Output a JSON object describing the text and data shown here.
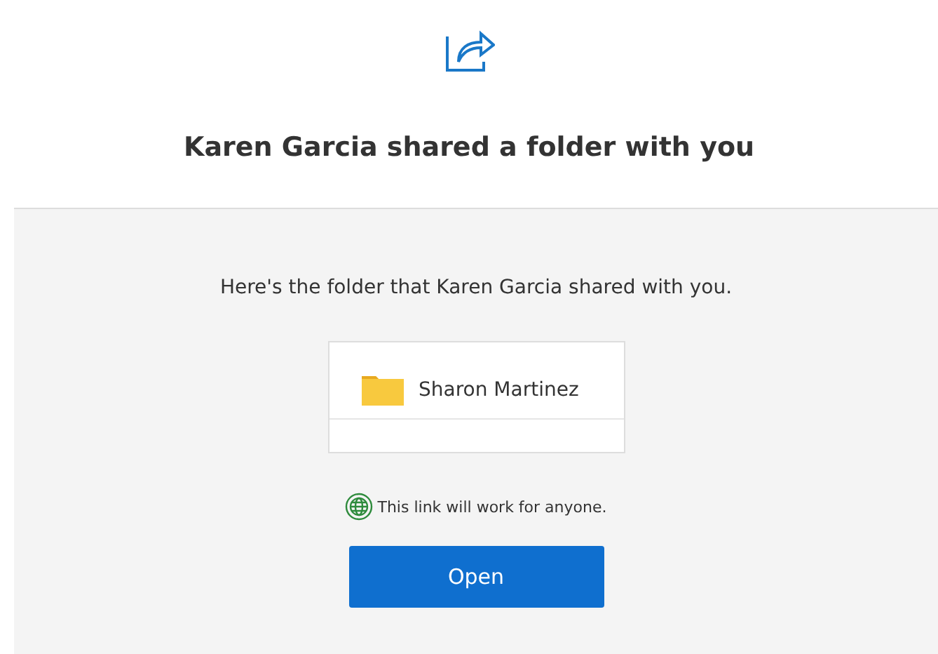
{
  "title": "Karen Garcia shared a folder with you",
  "message": "Here's the folder that Karen Garcia shared with you.",
  "folder": {
    "name": "Sharon Martinez"
  },
  "link_note": "This link will work for anyone.",
  "button": "Open"
}
